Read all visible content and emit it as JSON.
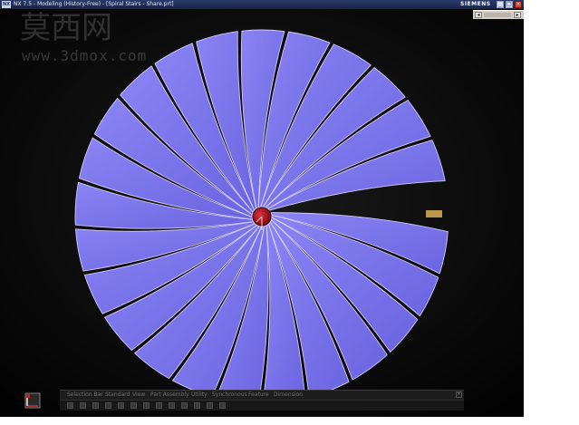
{
  "window": {
    "icon_label": "NX",
    "title": "NX 7.5 - Modeling (History-Free) - [Spiral Stairs - Share.prt]",
    "brand": "SIEMENS",
    "controls": {
      "minimize": "_",
      "maximize": "□",
      "close": "×"
    }
  },
  "subbar": {
    "left_arrow": "◂",
    "right_arrow": "▸"
  },
  "watermark": {
    "logo_text": "莫西网",
    "url": "www.3dmox.com"
  },
  "command_bar": {
    "items": [
      "Selection Bar",
      "Standard",
      "View",
      "Part Assembly",
      "Utility",
      "Synchronous",
      "Feature",
      "Dimension"
    ],
    "close_label": "×"
  },
  "colors": {
    "viewport_bg": "#050505",
    "tread_fill": "#7b74ea",
    "tread_edge": "#cfcaff",
    "center_post": "#b5121b",
    "gap_highlight": "#d9b15a"
  },
  "icons": {
    "app": "nx-app-icon",
    "triad": "wcs-triad-icon"
  }
}
